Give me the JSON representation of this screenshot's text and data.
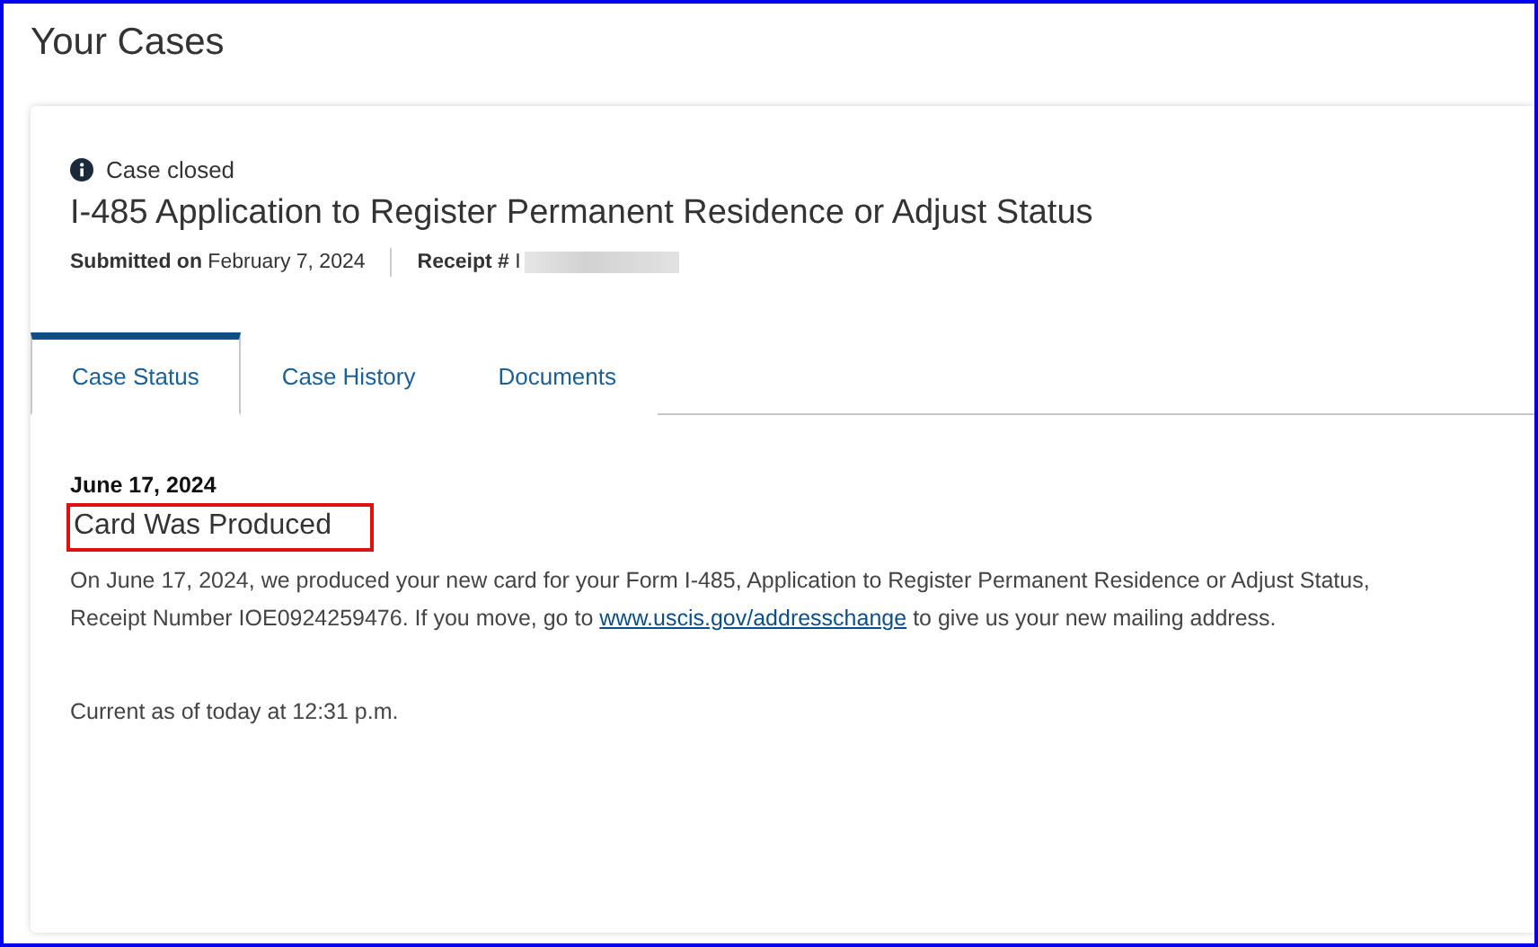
{
  "page_title": "Your Cases",
  "case": {
    "status": "Case closed",
    "title": "I-485 Application to Register Permanent Residence or Adjust Status",
    "submitted_label": "Submitted on",
    "submitted_date": "February 7, 2024",
    "receipt_label": "Receipt #",
    "receipt_value": "I",
    "receipt_redacted": true
  },
  "tabs": [
    {
      "label": "Case Status",
      "selected": true
    },
    {
      "label": "Case History",
      "selected": false
    },
    {
      "label": "Documents",
      "selected": false
    }
  ],
  "update": {
    "date": "June 17, 2024",
    "heading": "Card Was Produced",
    "heading_highlighted": true,
    "body_before": "On June 17, 2024, we produced your new card for your Form I-485, Application to Register Permanent Residence or Adjust Status, Receipt Number IOE0924259476. If you move, go to",
    "body_link": "www.uscis.gov/addresschange",
    "body_after": "to give us your new mailing address.",
    "current_as_of": "Current as of today at 12:31 p.m."
  }
}
